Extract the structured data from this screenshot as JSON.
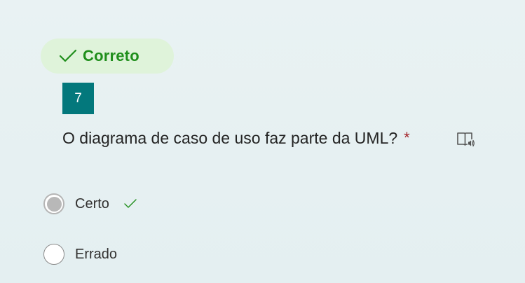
{
  "result": {
    "label": "Correto",
    "icon": "checkmark-icon",
    "color": "#1f8e1b",
    "background": "#dff3da"
  },
  "question": {
    "number": "7",
    "number_background": "#03787c",
    "text": "O diagrama de caso de uso faz parte da UML?",
    "required_mark": "*",
    "reader_icon": "immersive-reader-icon"
  },
  "options": [
    {
      "label": "Certo",
      "selected": true,
      "correct": true
    },
    {
      "label": "Errado",
      "selected": false,
      "correct": false
    }
  ]
}
